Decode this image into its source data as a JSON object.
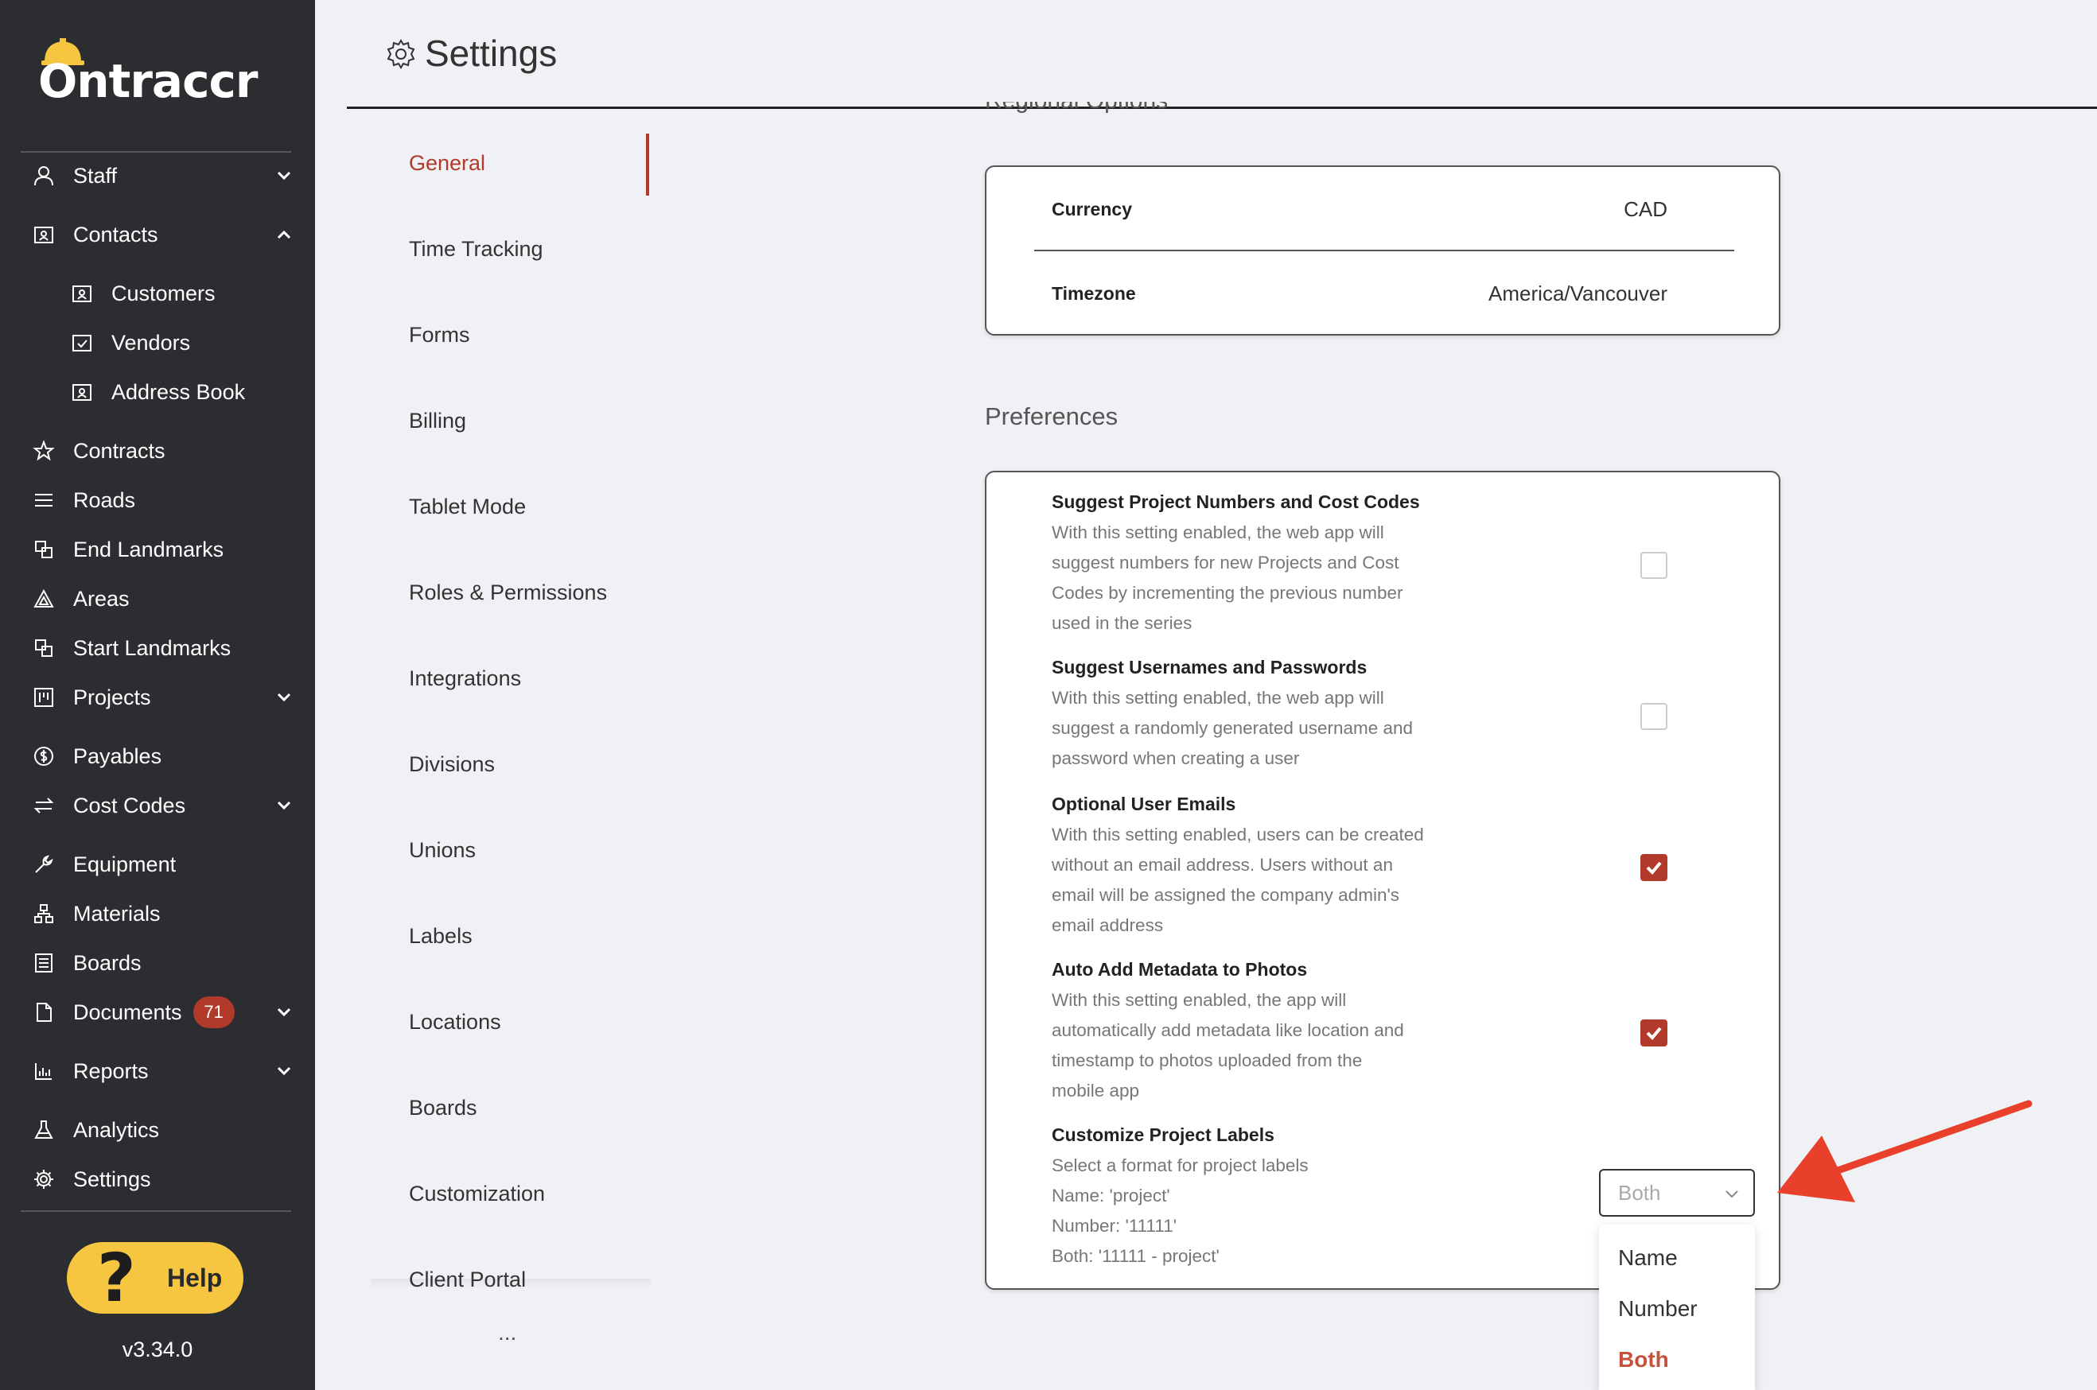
{
  "app": {
    "logo_text": "Ontraccr",
    "version": "v3.34.0",
    "help_label": "Help"
  },
  "sidebar": {
    "items": [
      {
        "label": "Staff",
        "icon": "person-icon",
        "chevron": "down"
      },
      {
        "label": "Contacts",
        "icon": "contact-card-icon",
        "chevron": "up"
      },
      {
        "label": "Customers",
        "icon": "contact-card-icon",
        "sub": true
      },
      {
        "label": "Vendors",
        "icon": "calendar-check-icon",
        "sub": true
      },
      {
        "label": "Address Book",
        "icon": "contact-card-icon",
        "sub": true
      },
      {
        "label": "Contracts",
        "icon": "star-icon"
      },
      {
        "label": "Roads",
        "icon": "road-icon"
      },
      {
        "label": "End Landmarks",
        "icon": "landmark-icon"
      },
      {
        "label": "Areas",
        "icon": "triangle-icon"
      },
      {
        "label": "Start Landmarks",
        "icon": "landmark-icon"
      },
      {
        "label": "Projects",
        "icon": "board-icon",
        "chevron": "down"
      },
      {
        "label": "Payables",
        "icon": "dollar-icon"
      },
      {
        "label": "Cost Codes",
        "icon": "swap-icon",
        "chevron": "down"
      },
      {
        "label": "Equipment",
        "icon": "wrench-icon"
      },
      {
        "label": "Materials",
        "icon": "hierarchy-icon"
      },
      {
        "label": "Boards",
        "icon": "list-board-icon"
      },
      {
        "label": "Documents",
        "icon": "document-icon",
        "badge": "71",
        "chevron": "down"
      },
      {
        "label": "Reports",
        "icon": "bar-chart-icon",
        "chevron": "down"
      },
      {
        "label": "Analytics",
        "icon": "flask-icon"
      },
      {
        "label": "Settings",
        "icon": "gear-icon"
      }
    ]
  },
  "header": {
    "title": "Settings",
    "icon": "gear-icon"
  },
  "tabs": [
    {
      "label": "General",
      "active": true
    },
    {
      "label": "Time Tracking"
    },
    {
      "label": "Forms"
    },
    {
      "label": "Billing"
    },
    {
      "label": "Tablet Mode"
    },
    {
      "label": "Roles & Permissions"
    },
    {
      "label": "Integrations"
    },
    {
      "label": "Divisions"
    },
    {
      "label": "Unions"
    },
    {
      "label": "Labels"
    },
    {
      "label": "Locations"
    },
    {
      "label": "Boards"
    },
    {
      "label": "Customization"
    },
    {
      "label": "Client Portal"
    }
  ],
  "tabs_more": "...",
  "regional": {
    "section_title": "Regional Options",
    "currency_label": "Currency",
    "currency_value": "CAD",
    "timezone_label": "Timezone",
    "timezone_value": "America/Vancouver"
  },
  "preferences": {
    "section_title": "Preferences",
    "items": [
      {
        "name": "Suggest Project Numbers and Cost Codes",
        "desc": [
          "With this setting enabled, the web app will",
          "suggest numbers for new Projects and Cost",
          "Codes by incrementing the previous number",
          "used in the series"
        ],
        "checked": false
      },
      {
        "name": "Suggest Usernames and Passwords",
        "desc": [
          "With this setting enabled, the web app will",
          "suggest a randomly generated username and",
          "password when creating a user"
        ],
        "checked": false
      },
      {
        "name": "Optional User Emails",
        "desc": [
          "With this setting enabled, users can be created",
          "without an email address. Users without an",
          "email will be assigned the company admin's",
          "email address"
        ],
        "checked": true
      },
      {
        "name": "Auto Add Metadata to Photos",
        "desc": [
          "With this setting enabled, the app will",
          "automatically add metadata like location and",
          "timestamp to photos uploaded from the",
          "mobile app"
        ],
        "checked": true
      },
      {
        "name": "Customize Project Labels",
        "desc": [
          "Select a format for project labels",
          "Name: 'project'",
          "Number: '11111'",
          "Both: '11111 - project'"
        ]
      }
    ],
    "label_format": {
      "value": "Both",
      "options": [
        "Name",
        "Number",
        "Both"
      ],
      "selected": "Both"
    }
  },
  "colors": {
    "sidebar_bg": "#2b2d31",
    "accent": "#b23a2a",
    "help_bg": "#f6c640",
    "arrow": "#e8402a"
  }
}
